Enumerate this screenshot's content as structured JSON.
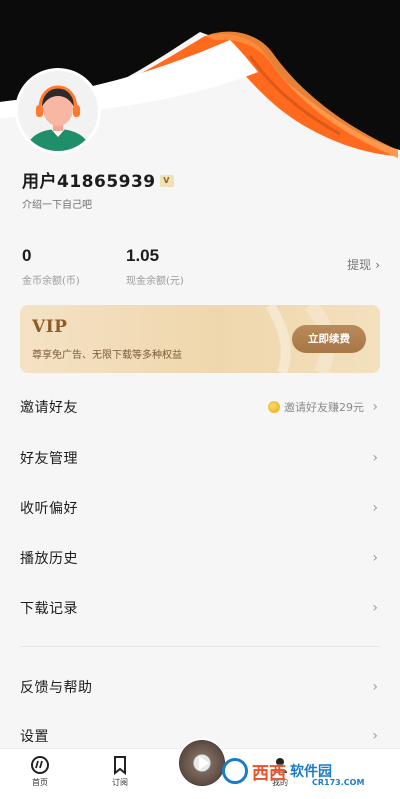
{
  "profile": {
    "username": "用户41865939",
    "vip_badge": "V",
    "bio": "介绍一下自己吧"
  },
  "stats": {
    "coins_value": "0",
    "coins_label": "金币余额(币)",
    "cash_value": "1.05",
    "cash_label": "现金余额(元)",
    "withdraw_label": "提现",
    "chevron": "›"
  },
  "vip": {
    "title": "VIP",
    "desc": "尊享免广告、无限下载等多种权益",
    "renew_label": "立即续费"
  },
  "menu": {
    "items": [
      {
        "label": "邀请好友",
        "extra": "邀请好友赚29元"
      },
      {
        "label": "好友管理"
      },
      {
        "label": "收听偏好"
      },
      {
        "label": "播放历史"
      },
      {
        "label": "下载记录"
      },
      {
        "label": "反馈与帮助"
      },
      {
        "label": "设置"
      }
    ],
    "chevron": "›"
  },
  "tabbar": {
    "tabs": [
      {
        "label": "首页",
        "icon": "home-icon"
      },
      {
        "label": "订阅",
        "icon": "bookmark-icon"
      },
      {
        "label": "我的",
        "icon": "profile-icon"
      }
    ]
  },
  "watermark": {
    "text": "西西",
    "brand": "软件园",
    "site": "CR173.COM"
  },
  "colors": {
    "accent_orange": "#ff7a2f",
    "vip_gold": "#a77647",
    "coin": "#e9a613"
  }
}
